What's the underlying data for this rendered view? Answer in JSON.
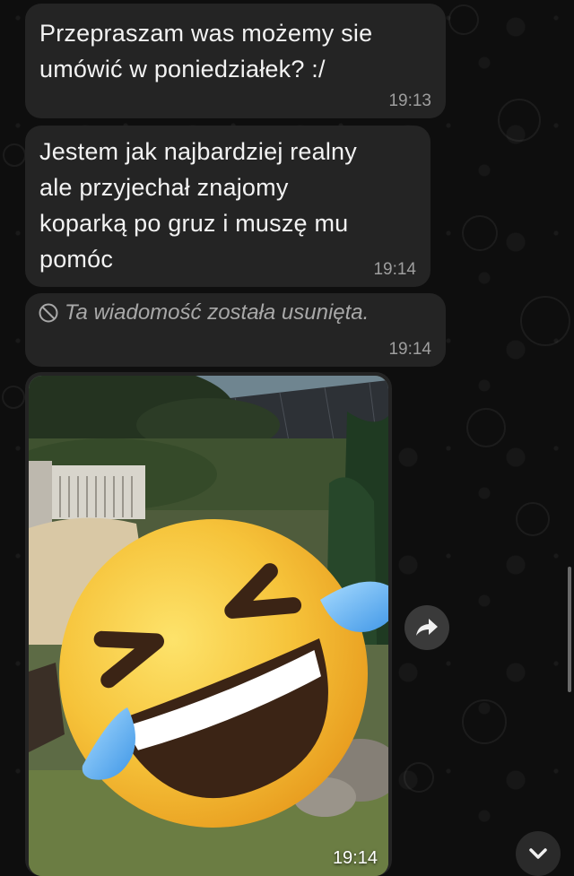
{
  "messages": [
    {
      "text_lines": [
        "Przepraszam was możemy sie",
        "umówić w poniedziałek? :/"
      ],
      "time": "19:13"
    },
    {
      "text_lines": [
        "Jestem jak najbardziej realny",
        "ale przyjechał znajomy",
        "koparką po gruz i muszę mu",
        "pomóc"
      ],
      "time": "19:14"
    },
    {
      "deleted_text": "Ta wiadomość została usunięta.",
      "time": "19:14"
    },
    {
      "type": "photo",
      "time": "19:14"
    }
  ],
  "icons": {
    "deleted": "prohibited-circle-icon",
    "forward": "forward-arrow-icon",
    "scroll_down": "chevron-down-icon",
    "emoji": "rolling-on-floor-laughing-emoji"
  },
  "colors": {
    "bubble": "#242424",
    "background": "#0e0e0e",
    "timestamp": "#9e9e9e"
  }
}
